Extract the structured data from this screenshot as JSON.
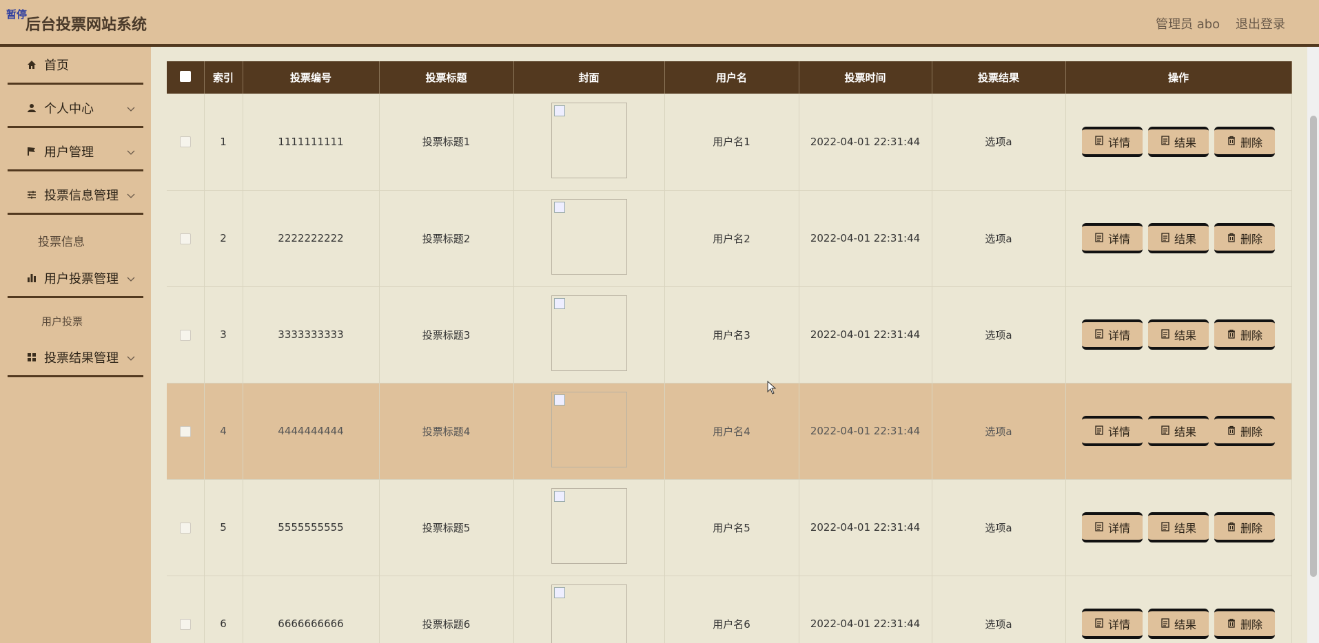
{
  "header": {
    "badge": "暂停",
    "title": "后台投票网站系统",
    "user": "管理员 abo",
    "logout": "退出登录"
  },
  "sidebar": {
    "items": [
      {
        "label": "首页",
        "icon": "home-icon"
      },
      {
        "label": "个人中心",
        "icon": "person-icon"
      },
      {
        "label": "用户管理",
        "icon": "flag-icon"
      },
      {
        "label": "投票信息管理",
        "icon": "sliders-icon"
      },
      {
        "label": "投票信息",
        "icon": ""
      },
      {
        "label": "用户投票管理",
        "icon": "bar-chart-icon"
      },
      {
        "label": "用户投票",
        "icon": ""
      },
      {
        "label": "投票结果管理",
        "icon": "grid-icon"
      }
    ]
  },
  "table": {
    "columns": [
      "索引",
      "投票编号",
      "投票标题",
      "封面",
      "用户名",
      "投票时间",
      "投票结果",
      "操作"
    ],
    "rows": [
      {
        "index": "1",
        "code": "1111111111",
        "title": "投票标题1",
        "user": "用户名1",
        "time": "2022-04-01 22:31:44",
        "result": "选项a"
      },
      {
        "index": "2",
        "code": "2222222222",
        "title": "投票标题2",
        "user": "用户名2",
        "time": "2022-04-01 22:31:44",
        "result": "选项a"
      },
      {
        "index": "3",
        "code": "3333333333",
        "title": "投票标题3",
        "user": "用户名3",
        "time": "2022-04-01 22:31:44",
        "result": "选项a"
      },
      {
        "index": "4",
        "code": "4444444444",
        "title": "投票标题4",
        "user": "用户名4",
        "time": "2022-04-01 22:31:44",
        "result": "选项a"
      },
      {
        "index": "5",
        "code": "5555555555",
        "title": "投票标题5",
        "user": "用户名5",
        "time": "2022-04-01 22:31:44",
        "result": "选项a"
      },
      {
        "index": "6",
        "code": "6666666666",
        "title": "投票标题6",
        "user": "用户名6",
        "time": "2022-04-01 22:31:44",
        "result": "选项a"
      }
    ],
    "actions": {
      "detail": "详情",
      "result": "结果",
      "delete": "删除"
    }
  },
  "colors": {
    "accent": "#dfc19b",
    "dark": "#53391f",
    "background": "#ebe7d4"
  }
}
